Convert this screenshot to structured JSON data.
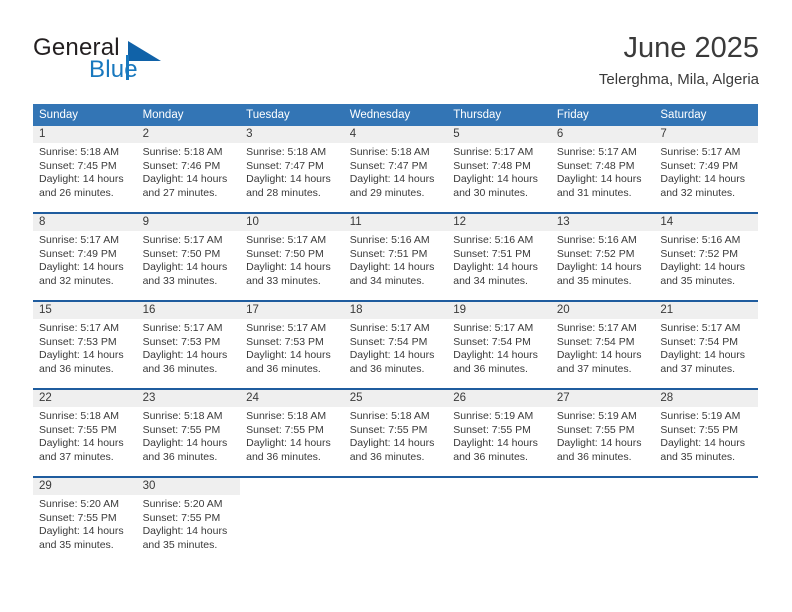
{
  "brand": {
    "name_part1": "General",
    "name_part2": "Blue",
    "logo_icon": "triangle-flag-icon"
  },
  "header": {
    "month_title": "June 2025",
    "location": "Telerghma, Mila, Algeria"
  },
  "colors": {
    "header_blue": "#3375b5",
    "separator_blue": "#1f5c9e",
    "daynum_band": "#efefef",
    "brand_blue": "#1878be",
    "text": "#3a3a3a"
  },
  "weekdays": [
    "Sunday",
    "Monday",
    "Tuesday",
    "Wednesday",
    "Thursday",
    "Friday",
    "Saturday"
  ],
  "weeks": [
    {
      "days": [
        {
          "num": "1",
          "sunrise": "Sunrise: 5:18 AM",
          "sunset": "Sunset: 7:45 PM",
          "daylight": "Daylight: 14 hours and 26 minutes."
        },
        {
          "num": "2",
          "sunrise": "Sunrise: 5:18 AM",
          "sunset": "Sunset: 7:46 PM",
          "daylight": "Daylight: 14 hours and 27 minutes."
        },
        {
          "num": "3",
          "sunrise": "Sunrise: 5:18 AM",
          "sunset": "Sunset: 7:47 PM",
          "daylight": "Daylight: 14 hours and 28 minutes."
        },
        {
          "num": "4",
          "sunrise": "Sunrise: 5:18 AM",
          "sunset": "Sunset: 7:47 PM",
          "daylight": "Daylight: 14 hours and 29 minutes."
        },
        {
          "num": "5",
          "sunrise": "Sunrise: 5:17 AM",
          "sunset": "Sunset: 7:48 PM",
          "daylight": "Daylight: 14 hours and 30 minutes."
        },
        {
          "num": "6",
          "sunrise": "Sunrise: 5:17 AM",
          "sunset": "Sunset: 7:48 PM",
          "daylight": "Daylight: 14 hours and 31 minutes."
        },
        {
          "num": "7",
          "sunrise": "Sunrise: 5:17 AM",
          "sunset": "Sunset: 7:49 PM",
          "daylight": "Daylight: 14 hours and 32 minutes."
        }
      ]
    },
    {
      "days": [
        {
          "num": "8",
          "sunrise": "Sunrise: 5:17 AM",
          "sunset": "Sunset: 7:49 PM",
          "daylight": "Daylight: 14 hours and 32 minutes."
        },
        {
          "num": "9",
          "sunrise": "Sunrise: 5:17 AM",
          "sunset": "Sunset: 7:50 PM",
          "daylight": "Daylight: 14 hours and 33 minutes."
        },
        {
          "num": "10",
          "sunrise": "Sunrise: 5:17 AM",
          "sunset": "Sunset: 7:50 PM",
          "daylight": "Daylight: 14 hours and 33 minutes."
        },
        {
          "num": "11",
          "sunrise": "Sunrise: 5:16 AM",
          "sunset": "Sunset: 7:51 PM",
          "daylight": "Daylight: 14 hours and 34 minutes."
        },
        {
          "num": "12",
          "sunrise": "Sunrise: 5:16 AM",
          "sunset": "Sunset: 7:51 PM",
          "daylight": "Daylight: 14 hours and 34 minutes."
        },
        {
          "num": "13",
          "sunrise": "Sunrise: 5:16 AM",
          "sunset": "Sunset: 7:52 PM",
          "daylight": "Daylight: 14 hours and 35 minutes."
        },
        {
          "num": "14",
          "sunrise": "Sunrise: 5:16 AM",
          "sunset": "Sunset: 7:52 PM",
          "daylight": "Daylight: 14 hours and 35 minutes."
        }
      ]
    },
    {
      "days": [
        {
          "num": "15",
          "sunrise": "Sunrise: 5:17 AM",
          "sunset": "Sunset: 7:53 PM",
          "daylight": "Daylight: 14 hours and 36 minutes."
        },
        {
          "num": "16",
          "sunrise": "Sunrise: 5:17 AM",
          "sunset": "Sunset: 7:53 PM",
          "daylight": "Daylight: 14 hours and 36 minutes."
        },
        {
          "num": "17",
          "sunrise": "Sunrise: 5:17 AM",
          "sunset": "Sunset: 7:53 PM",
          "daylight": "Daylight: 14 hours and 36 minutes."
        },
        {
          "num": "18",
          "sunrise": "Sunrise: 5:17 AM",
          "sunset": "Sunset: 7:54 PM",
          "daylight": "Daylight: 14 hours and 36 minutes."
        },
        {
          "num": "19",
          "sunrise": "Sunrise: 5:17 AM",
          "sunset": "Sunset: 7:54 PM",
          "daylight": "Daylight: 14 hours and 36 minutes."
        },
        {
          "num": "20",
          "sunrise": "Sunrise: 5:17 AM",
          "sunset": "Sunset: 7:54 PM",
          "daylight": "Daylight: 14 hours and 37 minutes."
        },
        {
          "num": "21",
          "sunrise": "Sunrise: 5:17 AM",
          "sunset": "Sunset: 7:54 PM",
          "daylight": "Daylight: 14 hours and 37 minutes."
        }
      ]
    },
    {
      "days": [
        {
          "num": "22",
          "sunrise": "Sunrise: 5:18 AM",
          "sunset": "Sunset: 7:55 PM",
          "daylight": "Daylight: 14 hours and 37 minutes."
        },
        {
          "num": "23",
          "sunrise": "Sunrise: 5:18 AM",
          "sunset": "Sunset: 7:55 PM",
          "daylight": "Daylight: 14 hours and 36 minutes."
        },
        {
          "num": "24",
          "sunrise": "Sunrise: 5:18 AM",
          "sunset": "Sunset: 7:55 PM",
          "daylight": "Daylight: 14 hours and 36 minutes."
        },
        {
          "num": "25",
          "sunrise": "Sunrise: 5:18 AM",
          "sunset": "Sunset: 7:55 PM",
          "daylight": "Daylight: 14 hours and 36 minutes."
        },
        {
          "num": "26",
          "sunrise": "Sunrise: 5:19 AM",
          "sunset": "Sunset: 7:55 PM",
          "daylight": "Daylight: 14 hours and 36 minutes."
        },
        {
          "num": "27",
          "sunrise": "Sunrise: 5:19 AM",
          "sunset": "Sunset: 7:55 PM",
          "daylight": "Daylight: 14 hours and 36 minutes."
        },
        {
          "num": "28",
          "sunrise": "Sunrise: 5:19 AM",
          "sunset": "Sunset: 7:55 PM",
          "daylight": "Daylight: 14 hours and 35 minutes."
        }
      ]
    },
    {
      "days": [
        {
          "num": "29",
          "sunrise": "Sunrise: 5:20 AM",
          "sunset": "Sunset: 7:55 PM",
          "daylight": "Daylight: 14 hours and 35 minutes."
        },
        {
          "num": "30",
          "sunrise": "Sunrise: 5:20 AM",
          "sunset": "Sunset: 7:55 PM",
          "daylight": "Daylight: 14 hours and 35 minutes."
        },
        {
          "num": "",
          "sunrise": "",
          "sunset": "",
          "daylight": ""
        },
        {
          "num": "",
          "sunrise": "",
          "sunset": "",
          "daylight": ""
        },
        {
          "num": "",
          "sunrise": "",
          "sunset": "",
          "daylight": ""
        },
        {
          "num": "",
          "sunrise": "",
          "sunset": "",
          "daylight": ""
        },
        {
          "num": "",
          "sunrise": "",
          "sunset": "",
          "daylight": ""
        }
      ]
    }
  ]
}
